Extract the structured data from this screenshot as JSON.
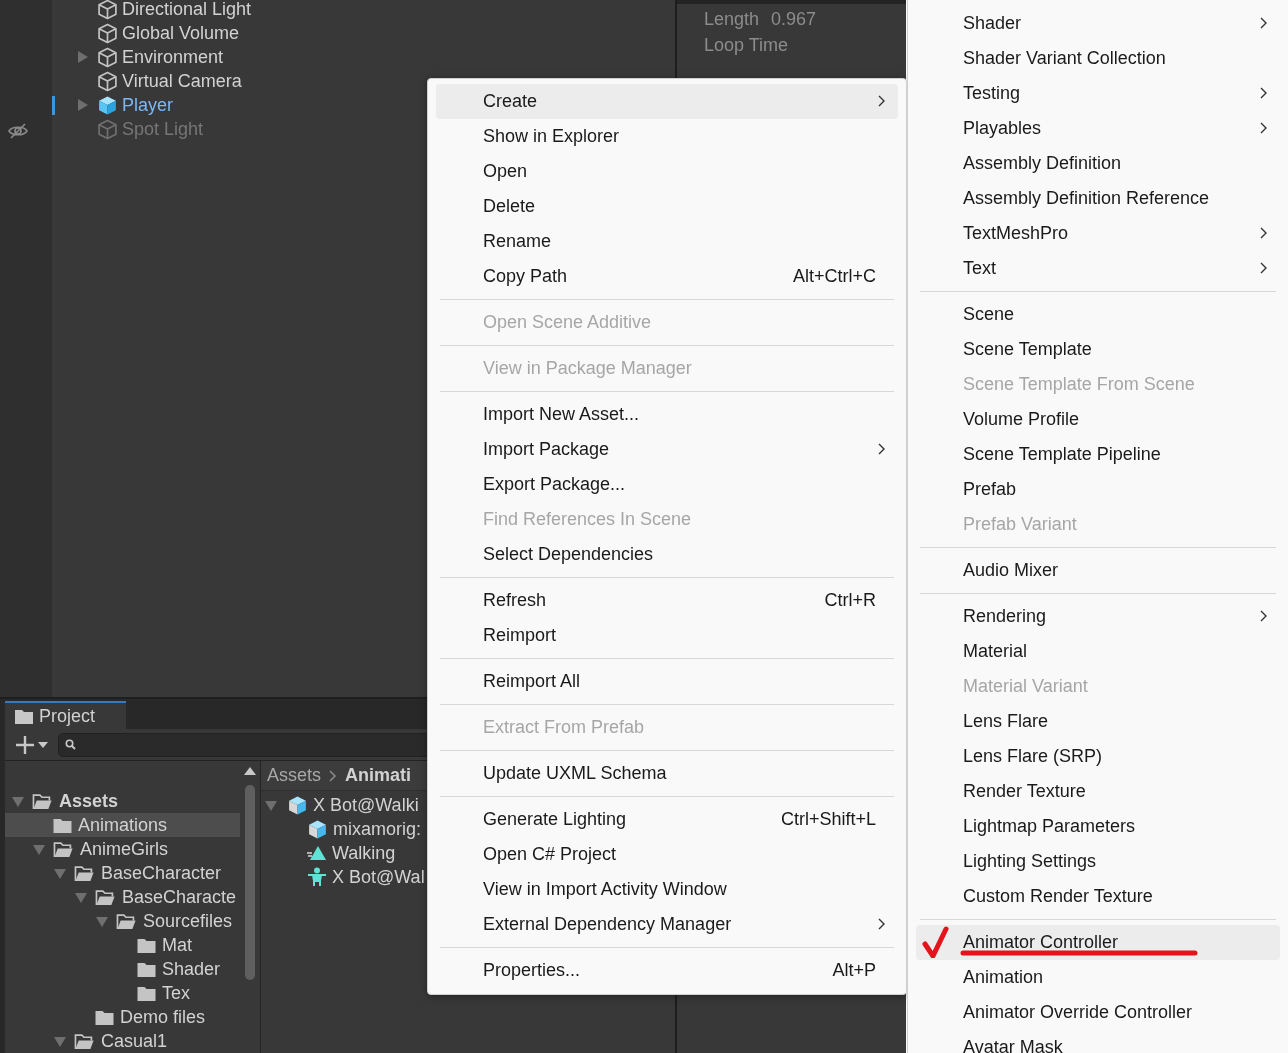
{
  "hierarchy": {
    "items": [
      {
        "label": "Directional Light",
        "has_children": false,
        "selected": false,
        "active": true
      },
      {
        "label": "Global Volume",
        "has_children": false,
        "selected": false,
        "active": true
      },
      {
        "label": "Environment",
        "has_children": true,
        "selected": false,
        "active": true
      },
      {
        "label": "Virtual Camera",
        "has_children": false,
        "selected": false,
        "active": true
      },
      {
        "label": "Player",
        "has_children": true,
        "selected": true,
        "active": true
      },
      {
        "label": "Spot Light",
        "has_children": false,
        "selected": false,
        "active": false
      }
    ]
  },
  "inspector": {
    "fields": [
      {
        "label": "Length",
        "value": "0.967"
      },
      {
        "label": "Loop Time"
      }
    ]
  },
  "project_panel": {
    "tab": "Project",
    "tree": [
      {
        "label": "Assets",
        "expanded": true,
        "selected": false,
        "children": [
          {
            "label": "Animations",
            "selected": true
          },
          {
            "label": "AnimeGirls",
            "expanded": true,
            "selected": false,
            "children": [
              {
                "label": "BaseCharacter",
                "expanded": true,
                "selected": false,
                "children": [
                  {
                    "label": "BaseCharacte",
                    "expanded": true,
                    "selected": false,
                    "children": [
                      {
                        "label": "Sourcefiles",
                        "expanded": true,
                        "selected": false,
                        "children": [
                          {
                            "label": "Mat",
                            "selected": false
                          },
                          {
                            "label": "Shader",
                            "selected": false
                          },
                          {
                            "label": "Tex",
                            "selected": false
                          }
                        ]
                      }
                    ]
                  },
                  {
                    "label": "Demo files",
                    "selected": false
                  }
                ]
              },
              {
                "label": "Casual1",
                "expanded": true,
                "selected": false
              }
            ]
          }
        ]
      }
    ],
    "breadcrumb": [
      "Assets",
      "Animati"
    ],
    "assets": [
      {
        "label": "X Bot@Walki",
        "kind": "model",
        "expanded": true
      },
      {
        "label": "mixamorig:",
        "kind": "model"
      },
      {
        "label": "Walking",
        "kind": "clip"
      },
      {
        "label": "X Bot@Wal",
        "kind": "avatar"
      }
    ]
  },
  "context_menu": {
    "items": [
      {
        "kind": "item",
        "label": "Create",
        "submenu": true,
        "disabled": false,
        "highlighted": true
      },
      {
        "kind": "item",
        "label": "Show in Explorer",
        "disabled": false,
        "highlighted": false
      },
      {
        "kind": "item",
        "label": "Open",
        "disabled": false,
        "highlighted": false
      },
      {
        "kind": "item",
        "label": "Delete",
        "disabled": false,
        "highlighted": false
      },
      {
        "kind": "item",
        "label": "Rename",
        "disabled": false,
        "highlighted": false
      },
      {
        "kind": "item",
        "label": "Copy Path",
        "shortcut": "Alt+Ctrl+C",
        "disabled": false,
        "highlighted": false
      },
      {
        "kind": "separator"
      },
      {
        "kind": "item",
        "label": "Open Scene Additive",
        "disabled": true,
        "highlighted": false
      },
      {
        "kind": "separator"
      },
      {
        "kind": "item",
        "label": "View in Package Manager",
        "disabled": true,
        "highlighted": false
      },
      {
        "kind": "separator"
      },
      {
        "kind": "item",
        "label": "Import New Asset...",
        "disabled": false,
        "highlighted": false
      },
      {
        "kind": "item",
        "label": "Import Package",
        "submenu": true,
        "disabled": false,
        "highlighted": false
      },
      {
        "kind": "item",
        "label": "Export Package...",
        "disabled": false,
        "highlighted": false
      },
      {
        "kind": "item",
        "label": "Find References In Scene",
        "disabled": true,
        "highlighted": false
      },
      {
        "kind": "item",
        "label": "Select Dependencies",
        "disabled": false,
        "highlighted": false
      },
      {
        "kind": "separator"
      },
      {
        "kind": "item",
        "label": "Refresh",
        "shortcut": "Ctrl+R",
        "disabled": false,
        "highlighted": false
      },
      {
        "kind": "item",
        "label": "Reimport",
        "disabled": false,
        "highlighted": false
      },
      {
        "kind": "separator"
      },
      {
        "kind": "item",
        "label": "Reimport All",
        "disabled": false,
        "highlighted": false
      },
      {
        "kind": "separator"
      },
      {
        "kind": "item",
        "label": "Extract From Prefab",
        "disabled": true,
        "highlighted": false
      },
      {
        "kind": "separator"
      },
      {
        "kind": "item",
        "label": "Update UXML Schema",
        "disabled": false,
        "highlighted": false
      },
      {
        "kind": "separator"
      },
      {
        "kind": "item",
        "label": "Generate Lighting",
        "shortcut": "Ctrl+Shift+L",
        "disabled": false,
        "highlighted": false
      },
      {
        "kind": "item",
        "label": "Open C# Project",
        "disabled": false,
        "highlighted": false
      },
      {
        "kind": "item",
        "label": "View in Import Activity Window",
        "disabled": false,
        "highlighted": false
      },
      {
        "kind": "item",
        "label": "External Dependency Manager",
        "submenu": true,
        "disabled": false,
        "highlighted": false
      },
      {
        "kind": "separator"
      },
      {
        "kind": "item",
        "label": "Properties...",
        "shortcut": "Alt+P",
        "disabled": false,
        "highlighted": false
      }
    ]
  },
  "create_submenu": {
    "items": [
      {
        "kind": "item",
        "label": "Shader",
        "submenu": true,
        "disabled": false,
        "highlighted": false
      },
      {
        "kind": "item",
        "label": "Shader Variant Collection",
        "disabled": false,
        "highlighted": false
      },
      {
        "kind": "item",
        "label": "Testing",
        "submenu": true,
        "disabled": false,
        "highlighted": false
      },
      {
        "kind": "item",
        "label": "Playables",
        "submenu": true,
        "disabled": false,
        "highlighted": false
      },
      {
        "kind": "item",
        "label": "Assembly Definition",
        "disabled": false,
        "highlighted": false
      },
      {
        "kind": "item",
        "label": "Assembly Definition Reference",
        "disabled": false,
        "highlighted": false
      },
      {
        "kind": "item",
        "label": "TextMeshPro",
        "submenu": true,
        "disabled": false,
        "highlighted": false
      },
      {
        "kind": "item",
        "label": "Text",
        "submenu": true,
        "disabled": false,
        "highlighted": false
      },
      {
        "kind": "separator"
      },
      {
        "kind": "item",
        "label": "Scene",
        "disabled": false,
        "highlighted": false
      },
      {
        "kind": "item",
        "label": "Scene Template",
        "disabled": false,
        "highlighted": false
      },
      {
        "kind": "item",
        "label": "Scene Template From Scene",
        "disabled": true,
        "highlighted": false
      },
      {
        "kind": "item",
        "label": "Volume Profile",
        "disabled": false,
        "highlighted": false
      },
      {
        "kind": "item",
        "label": "Scene Template Pipeline",
        "disabled": false,
        "highlighted": false
      },
      {
        "kind": "item",
        "label": "Prefab",
        "disabled": false,
        "highlighted": false
      },
      {
        "kind": "item",
        "label": "Prefab Variant",
        "disabled": true,
        "highlighted": false
      },
      {
        "kind": "separator"
      },
      {
        "kind": "item",
        "label": "Audio Mixer",
        "disabled": false,
        "highlighted": false
      },
      {
        "kind": "separator"
      },
      {
        "kind": "item",
        "label": "Rendering",
        "submenu": true,
        "disabled": false,
        "highlighted": false
      },
      {
        "kind": "item",
        "label": "Material",
        "disabled": false,
        "highlighted": false
      },
      {
        "kind": "item",
        "label": "Material Variant",
        "disabled": true,
        "highlighted": false
      },
      {
        "kind": "item",
        "label": "Lens Flare",
        "disabled": false,
        "highlighted": false
      },
      {
        "kind": "item",
        "label": "Lens Flare (SRP)",
        "disabled": false,
        "highlighted": false
      },
      {
        "kind": "item",
        "label": "Render Texture",
        "disabled": false,
        "highlighted": false
      },
      {
        "kind": "item",
        "label": "Lightmap Parameters",
        "disabled": false,
        "highlighted": false
      },
      {
        "kind": "item",
        "label": "Lighting Settings",
        "disabled": false,
        "highlighted": false
      },
      {
        "kind": "item",
        "label": "Custom Render Texture",
        "disabled": false,
        "highlighted": false
      },
      {
        "kind": "separator"
      },
      {
        "kind": "item",
        "label": "Animator Controller",
        "disabled": false,
        "highlighted": true,
        "annotated": true
      },
      {
        "kind": "item",
        "label": "Animation",
        "disabled": false,
        "highlighted": false
      },
      {
        "kind": "item",
        "label": "Animator Override Controller",
        "disabled": false,
        "highlighted": false
      },
      {
        "kind": "item",
        "label": "Avatar Mask",
        "disabled": false,
        "highlighted": false
      }
    ]
  }
}
